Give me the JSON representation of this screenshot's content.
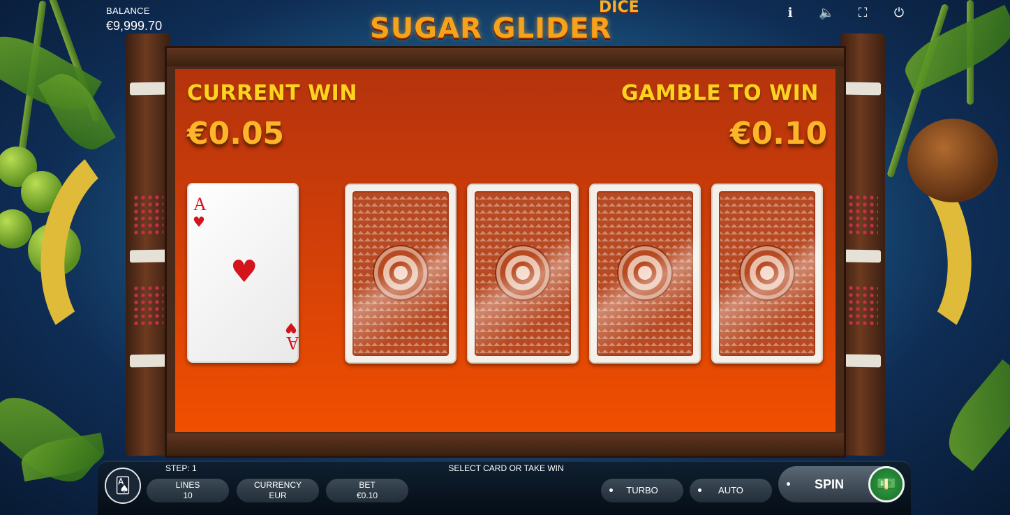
{
  "hud": {
    "balance_label": "BALANCE",
    "balance_value": "€9,999.70",
    "icons": [
      "info-icon",
      "sound-icon",
      "fullscreen-icon",
      "power-icon"
    ]
  },
  "logo": {
    "main": "SUGAR GLIDER",
    "sub": "DICE"
  },
  "gamble": {
    "current_win_label": "CURRENT WIN",
    "current_win_value": "€0.05",
    "gamble_to_win_label": "GAMBLE TO WIN",
    "gamble_to_win_value": "€0.10",
    "dealer_card": {
      "rank": "A",
      "suit": "♥"
    },
    "hidden_cards": 4
  },
  "colors": {
    "felt": "#cc3d0a",
    "title_yellow": "#ffd21f",
    "amount_orange": "#ffb52a",
    "card_back": "#b74a22"
  },
  "bottom": {
    "step": "STEP: 1",
    "message": "SELECT CARD OR TAKE WIN",
    "lines_label": "LINES",
    "lines_value": "10",
    "currency_label": "CURRENCY",
    "currency_value": "EUR",
    "bet_label": "BET",
    "bet_value": "€0.10",
    "turbo": "TURBO",
    "auto": "AUTO",
    "spin": "SPIN"
  }
}
